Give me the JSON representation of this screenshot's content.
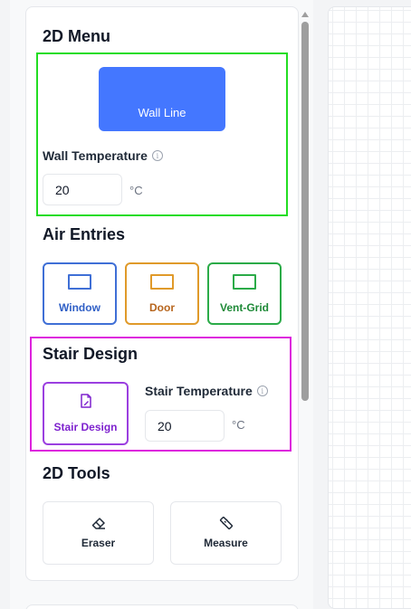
{
  "menu2d": {
    "title": "2D Menu",
    "wall_line_label": "Wall Line",
    "wall_temperature_label": "Wall Temperature",
    "wall_temperature_value": "20",
    "unit": "°C"
  },
  "air_entries": {
    "title": "Air Entries",
    "window_label": "Window",
    "door_label": "Door",
    "vent_label": "Vent-Grid",
    "colors": {
      "window": "#3f6fd6",
      "door": "#e09a2a",
      "vent": "#2bab48"
    }
  },
  "stair": {
    "title": "Stair Design",
    "button_label": "Stair Design",
    "temperature_label": "Stair Temperature",
    "temperature_value": "20",
    "unit": "°C"
  },
  "tools": {
    "title": "2D Tools",
    "eraser_label": "Eraser",
    "measure_label": "Measure"
  },
  "icons": {
    "info": "info-icon",
    "stair": "stair-design-icon",
    "eraser": "eraser-icon",
    "measure": "ruler-icon",
    "window": "window-icon",
    "door": "door-icon",
    "vent": "vent-grid-icon"
  },
  "colors": {
    "primary": "#4477ff",
    "highlight_green": "#22dd22",
    "highlight_magenta": "#dd22dd",
    "stair_accent": "#9b3fe0"
  }
}
